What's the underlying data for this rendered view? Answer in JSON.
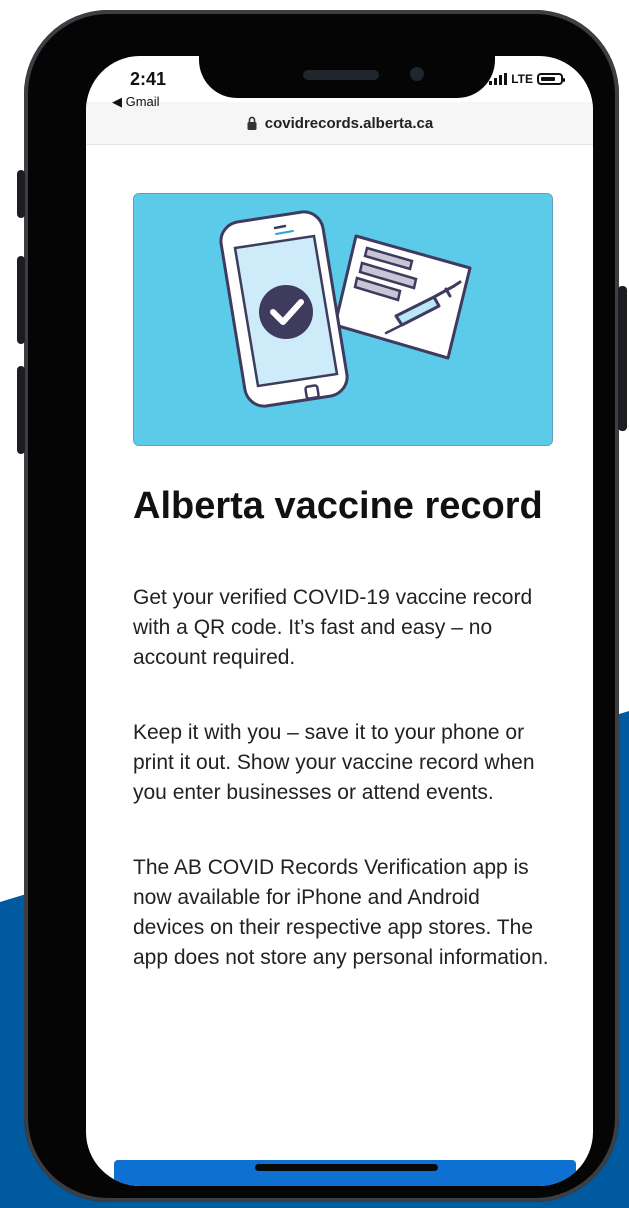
{
  "colors": {
    "accent_blue": "#005aa0",
    "hero_bg": "#5ccbea",
    "button_blue": "#0e70d0"
  },
  "status_bar": {
    "time": "2:41",
    "back_label": "◀ Gmail",
    "network": "LTE"
  },
  "browser": {
    "url": "covidrecords.alberta.ca"
  },
  "icons": {
    "hero": "phone-checkmark-vaccine-card-illustration",
    "lock": "lock-icon",
    "signal": "signal-icon",
    "battery": "battery-icon"
  },
  "page": {
    "title": "Alberta vaccine record",
    "paragraphs": [
      "Get your verified COVID-19 vaccine record with a QR code. It’s fast and easy – no account required.",
      "Keep it with you – save it to your phone or print it out. Show your vaccine record when you enter businesses or attend events.",
      "The AB COVID Records Verification app is now available for iPhone and Android devices on their respective app stores. The app does not store any personal information."
    ]
  }
}
